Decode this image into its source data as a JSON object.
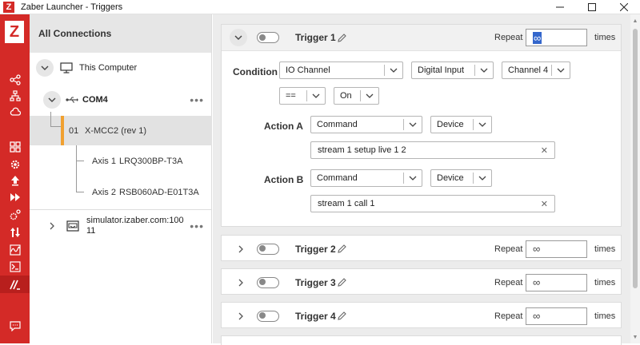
{
  "window": {
    "title": "Zaber Launcher - Triggers",
    "logo": "Z",
    "min_icon": "minimize-icon",
    "max_icon": "maximize-icon",
    "close_icon": "close-icon"
  },
  "rail": {
    "logo": "Z",
    "icons": [
      "share-icon",
      "network-icon",
      "cloud-icon",
      "grid-icon",
      "gear-icon",
      "upload-icon",
      "fast-forward-icon",
      "settings-icon",
      "arrows-icon",
      "oscilloscope-icon",
      "terminal-icon",
      "triggers-icon",
      "chat-icon"
    ]
  },
  "connections": {
    "header": "All Connections",
    "computer": "This Computer",
    "port": "COM4",
    "controller_index": "01",
    "controller": "X-MCC2 (rev 1)",
    "axes": [
      {
        "label": "Axis 1",
        "device": "LRQ300BP-T3A"
      },
      {
        "label": "Axis 2",
        "device": "RSB060AD-E01T3A"
      }
    ],
    "simulator_line1": "simulator.izaber.com:100",
    "simulator_line2": "11",
    "more": "•••"
  },
  "triggers": [
    {
      "title": "Trigger 1",
      "expanded": true,
      "repeat_label": "Repeat",
      "repeat_value": "∞",
      "times_label": "times",
      "condition": {
        "label": "Condition",
        "source": "IO Channel",
        "type": "Digital Input",
        "channel": "Channel 4",
        "operator": "==",
        "value": "On"
      },
      "action_a": {
        "label": "Action A",
        "kind": "Command",
        "target": "Device",
        "command": "stream 1 setup live 1 2"
      },
      "action_b": {
        "label": "Action B",
        "kind": "Command",
        "target": "Device",
        "command": "stream 1 call 1"
      }
    },
    {
      "title": "Trigger 2",
      "repeat_label": "Repeat",
      "repeat_value": "∞",
      "times_label": "times"
    },
    {
      "title": "Trigger 3",
      "repeat_label": "Repeat",
      "repeat_value": "∞",
      "times_label": "times"
    },
    {
      "title": "Trigger 4",
      "repeat_label": "Repeat",
      "repeat_value": "∞",
      "times_label": "times"
    }
  ],
  "clear_glyph": "✕",
  "colors": {
    "brand": "#d42a27",
    "accent": "#f0a030"
  }
}
